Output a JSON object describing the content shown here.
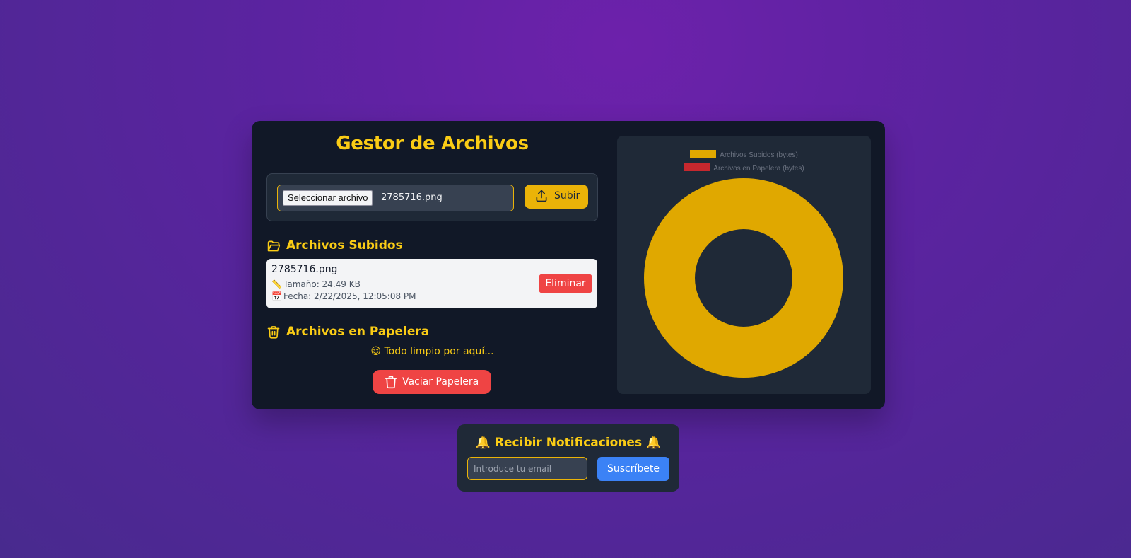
{
  "app": {
    "title": "Gestor de Archivos"
  },
  "upload": {
    "choose_label": "Seleccionar archivo",
    "selected_file": "2785716.png",
    "submit_label": "Subir"
  },
  "uploaded": {
    "heading": "Archivos Subidos",
    "files": [
      {
        "name": "2785716.png",
        "size_text": "Tamaño: 24.49 KB",
        "date_text": "Fecha: 2/22/2025, 12:05:08 PM",
        "delete_label": "Eliminar"
      }
    ]
  },
  "trash": {
    "heading": "Archivos en Papelera",
    "empty_message": "😌 Todo limpio por aquí...",
    "empty_button": "Vaciar Papelera"
  },
  "chart_data": {
    "type": "pie",
    "variant": "doughnut",
    "categories": [
      "Archivos Subidos (bytes)",
      "Archivos en Papelera (bytes)"
    ],
    "values": [
      25078,
      0
    ],
    "colors": [
      "#e0a800",
      "#c6282e"
    ],
    "legend_position": "top"
  },
  "notifications": {
    "title": "🔔 Recibir Notificaciones 🔔",
    "email_placeholder": "Introduce tu email",
    "subscribe_label": "Suscríbete"
  },
  "colors": {
    "accent": "#facc15",
    "danger": "#ef4444",
    "primary": "#3b82f6",
    "card_bg": "#111827",
    "panel_bg": "#1f2937"
  }
}
